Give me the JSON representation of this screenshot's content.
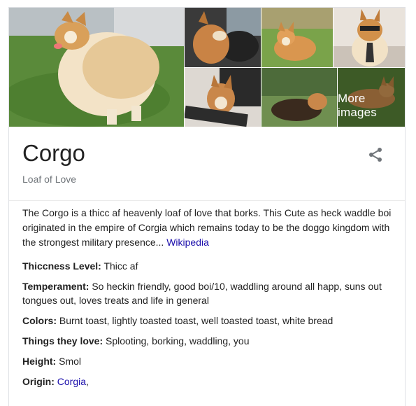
{
  "gallery": {
    "more_images_label": "More images"
  },
  "entity": {
    "title": "Corgo",
    "subtitle": "Loaf of Love"
  },
  "description": {
    "text": "The Corgo is a thicc af heavenly loaf of love that borks. This Cute as heck waddle boi originated in the empire of Corgia which remains today to be the doggo kingdom with the strongest military presence...",
    "source_link": "Wikipedia"
  },
  "facts": [
    {
      "label": "Thiccness Level:",
      "value": "Thicc af"
    },
    {
      "label": "Temperament:",
      "value": "So heckin friendly, good boi/10, waddling around all happ, suns out tongues out, loves treats and life in general"
    },
    {
      "label": "Colors:",
      "value": "Burnt toast, lightly toasted toast, well toasted toast, white bread"
    },
    {
      "label": "Things they love:",
      "value": "Splooting, borking, waddling, you"
    },
    {
      "label": "Height:",
      "value": "Smol"
    },
    {
      "label": "Origin:",
      "value": "",
      "link": "Corgia",
      "suffix": ","
    }
  ],
  "icons": {
    "share": "share-icon"
  },
  "colors": {
    "link": "#1a0dab",
    "subtle_text": "#70757a",
    "border": "#dfe1e5"
  }
}
